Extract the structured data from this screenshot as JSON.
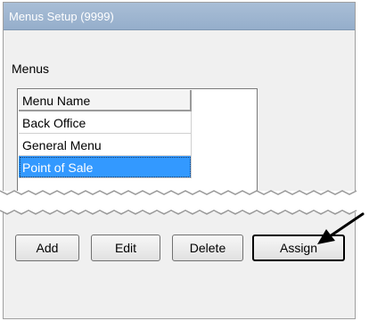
{
  "window": {
    "title": "Menus Setup (9999)"
  },
  "menus": {
    "label": "Menus",
    "column_header": "Menu Name",
    "rows": [
      "Back Office",
      "General Menu",
      "Point of Sale"
    ],
    "selected_index": 2
  },
  "buttons": {
    "add": "Add",
    "edit": "Edit",
    "delete": "Delete",
    "assign": "Assign"
  },
  "colors": {
    "titlebar": "#a3b9d3",
    "selection": "#3399ff",
    "window_bg": "#f0f0f0"
  }
}
